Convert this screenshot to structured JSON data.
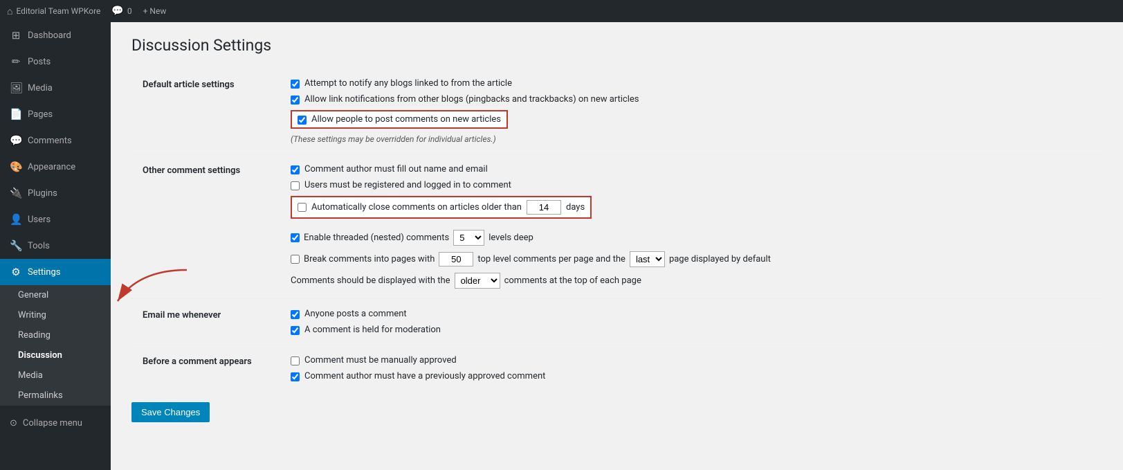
{
  "topbar": {
    "site_name": "Editorial Team WPKore",
    "comments_count": "0",
    "new_label": "+ New"
  },
  "sidebar": {
    "menu_items": [
      {
        "id": "dashboard",
        "label": "Dashboard",
        "icon": "⚙"
      },
      {
        "id": "posts",
        "label": "Posts",
        "icon": "✏"
      },
      {
        "id": "media",
        "label": "Media",
        "icon": "🖼"
      },
      {
        "id": "pages",
        "label": "Pages",
        "icon": "📄"
      },
      {
        "id": "comments",
        "label": "Comments",
        "icon": "💬"
      },
      {
        "id": "appearance",
        "label": "Appearance",
        "icon": "🎨"
      },
      {
        "id": "plugins",
        "label": "Plugins",
        "icon": "🔌"
      },
      {
        "id": "users",
        "label": "Users",
        "icon": "👤"
      },
      {
        "id": "tools",
        "label": "Tools",
        "icon": "🔧"
      },
      {
        "id": "settings",
        "label": "Settings",
        "icon": "⚙",
        "active": true
      }
    ],
    "submenu_items": [
      {
        "id": "general",
        "label": "General"
      },
      {
        "id": "writing",
        "label": "Writing"
      },
      {
        "id": "reading",
        "label": "Reading"
      },
      {
        "id": "discussion",
        "label": "Discussion",
        "active": true
      },
      {
        "id": "media",
        "label": "Media"
      },
      {
        "id": "permalinks",
        "label": "Permalinks"
      }
    ],
    "collapse_label": "Collapse menu"
  },
  "page": {
    "title": "Discussion Settings"
  },
  "sections": {
    "default_article": {
      "label": "Default article settings",
      "items": [
        {
          "id": "notify_blogs",
          "checked": true,
          "label": "Attempt to notify any blogs linked to from the article"
        },
        {
          "id": "allow_pingbacks",
          "checked": true,
          "label": "Allow link notifications from other blogs (pingbacks and trackbacks) on new articles"
        },
        {
          "id": "allow_comments",
          "checked": true,
          "label": "Allow people to post comments on new articles",
          "highlighted": true
        }
      ],
      "override_note": "(These settings may be overridden for individual articles.)"
    },
    "other_comment": {
      "label": "Other comment settings",
      "items": [
        {
          "id": "author_name_email",
          "checked": true,
          "label": "Comment author must fill out name and email",
          "type": "normal"
        },
        {
          "id": "registered_logged_in",
          "checked": false,
          "label": "Users must be registered and logged in to comment",
          "type": "normal"
        },
        {
          "id": "auto_close",
          "checked": false,
          "label": "Automatically close comments on articles older than",
          "type": "auto_close",
          "days_value": "14",
          "highlighted": true
        },
        {
          "id": "threaded_comments",
          "checked": true,
          "label": "Enable threaded (nested) comments",
          "type": "threaded",
          "levels": "5"
        },
        {
          "id": "break_pages",
          "checked": false,
          "label": "Break comments into pages with",
          "type": "break_pages",
          "per_page": "50",
          "page_order": "last"
        },
        {
          "id": "display_order",
          "type": "display_order",
          "order": "older",
          "label": "Comments should be displayed with the",
          "suffix": "comments at the top of each page"
        }
      ]
    },
    "email_me": {
      "label": "Email me whenever",
      "items": [
        {
          "id": "anyone_posts",
          "checked": true,
          "label": "Anyone posts a comment"
        },
        {
          "id": "held_moderation",
          "checked": true,
          "label": "A comment is held for moderation"
        }
      ]
    },
    "before_comment": {
      "label": "Before a comment appears",
      "items": [
        {
          "id": "manually_approved",
          "checked": false,
          "label": "Comment must be manually approved"
        },
        {
          "id": "previously_approved",
          "checked": true,
          "label": "Comment author must have a previously approved comment"
        }
      ]
    }
  },
  "save_button_label": "Save Changes"
}
